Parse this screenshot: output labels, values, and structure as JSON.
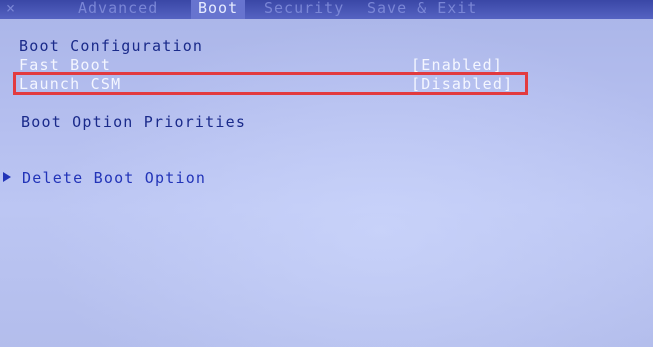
{
  "tabs": [
    {
      "label": "Advanced"
    },
    {
      "label": "Boot"
    },
    {
      "label": "Security"
    },
    {
      "label": "Save & Exit"
    }
  ],
  "section": {
    "title": "Boot Configuration"
  },
  "settings": [
    {
      "label": "Fast Boot",
      "value": "[Enabled]"
    },
    {
      "label": "Launch CSM",
      "value": "[Disabled]"
    }
  ],
  "priorities": {
    "label": "Boot Option Priorities"
  },
  "menu": {
    "delete_boot_option": "Delete Boot Option"
  },
  "colors": {
    "highlight": "#e23a3f",
    "heading": "#1a2a8a",
    "link": "#2234b8",
    "active_tab_bg": "#6774cf"
  }
}
